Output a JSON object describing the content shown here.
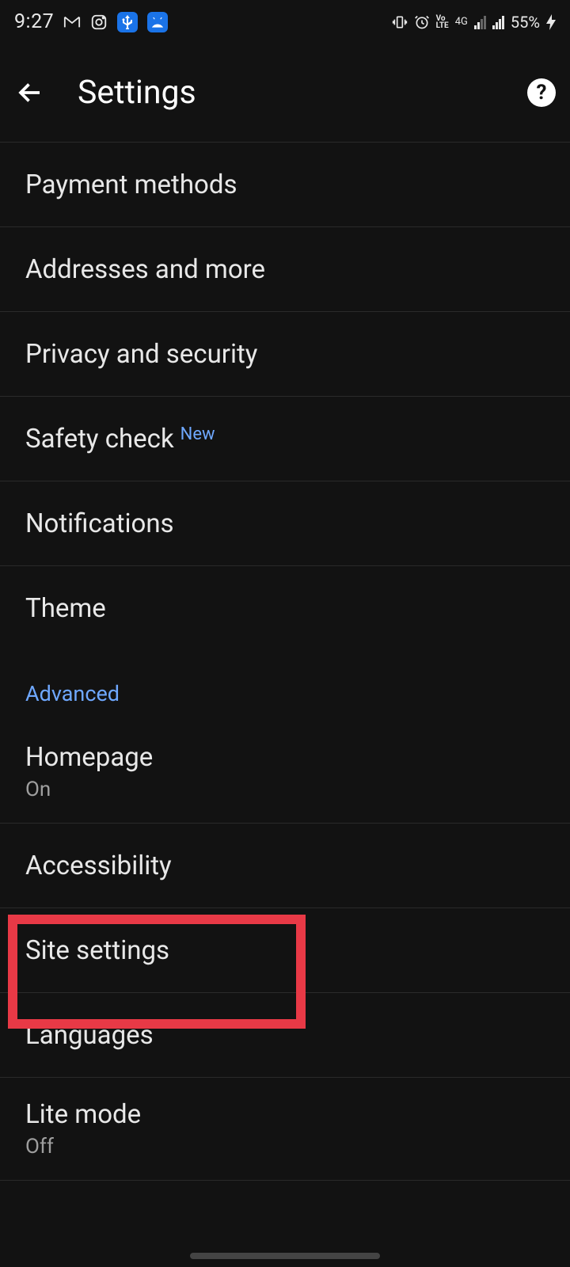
{
  "statusBar": {
    "time": "9:27",
    "battery": "55%",
    "network": "4G",
    "volte": "Vo LTE"
  },
  "header": {
    "title": "Settings"
  },
  "sections": {
    "basic": [
      {
        "label": "Payment methods"
      },
      {
        "label": "Addresses and more"
      },
      {
        "label": "Privacy and security"
      },
      {
        "label": "Safety check",
        "badge": "New"
      },
      {
        "label": "Notifications"
      },
      {
        "label": "Theme"
      }
    ],
    "advancedHeader": "Advanced",
    "advanced": [
      {
        "label": "Homepage",
        "sublabel": "On"
      },
      {
        "label": "Accessibility"
      },
      {
        "label": "Site settings"
      },
      {
        "label": "Languages"
      },
      {
        "label": "Lite mode",
        "sublabel": "Off"
      }
    ]
  }
}
